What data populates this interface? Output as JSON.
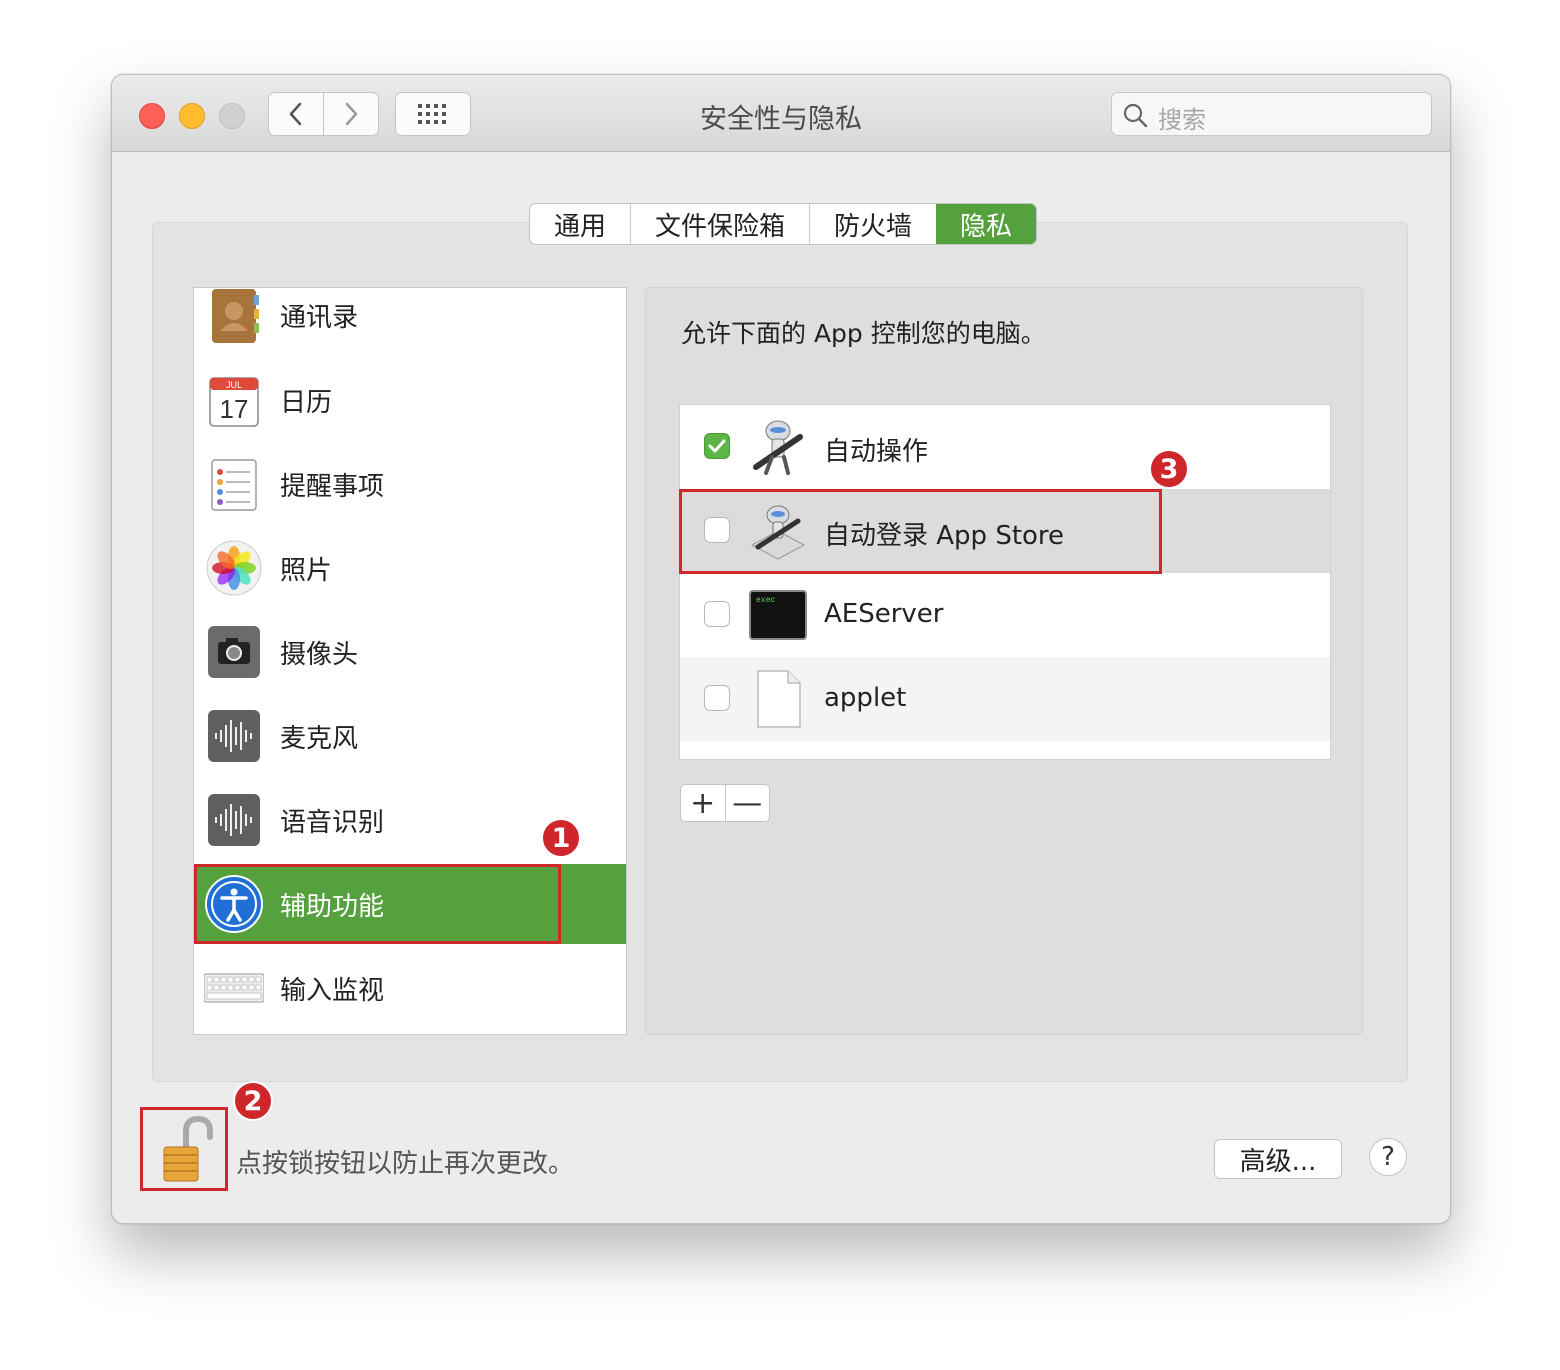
{
  "window": {
    "title": "安全性与隐私",
    "search_placeholder": "搜索"
  },
  "tabs": [
    {
      "label": "通用",
      "active": false
    },
    {
      "label": "文件保险箱",
      "active": false
    },
    {
      "label": "防火墙",
      "active": false
    },
    {
      "label": "隐私",
      "active": true
    }
  ],
  "sidebar": {
    "items": [
      {
        "label": "通讯录",
        "icon": "contacts-icon"
      },
      {
        "label": "日历",
        "icon": "calendar-icon",
        "calendar_month": "JUL",
        "calendar_day": "17"
      },
      {
        "label": "提醒事项",
        "icon": "reminders-icon"
      },
      {
        "label": "照片",
        "icon": "photos-icon"
      },
      {
        "label": "摄像头",
        "icon": "camera-icon"
      },
      {
        "label": "麦克风",
        "icon": "microphone-icon"
      },
      {
        "label": "语音识别",
        "icon": "speech-recognition-icon"
      },
      {
        "label": "辅助功能",
        "icon": "accessibility-icon",
        "selected": true
      },
      {
        "label": "输入监视",
        "icon": "keyboard-icon"
      }
    ]
  },
  "panel": {
    "description": "允许下面的 App 控制您的电脑。",
    "apps": [
      {
        "label": "自动操作",
        "checked": true,
        "icon": "automator-icon"
      },
      {
        "label": "自动登录 App Store",
        "checked": false,
        "icon": "automator-workflow-icon"
      },
      {
        "label": "AEServer",
        "checked": false,
        "icon": "terminal-exec-icon",
        "icon_text": "exec"
      },
      {
        "label": "applet",
        "checked": false,
        "icon": "document-icon"
      }
    ],
    "add_label": "+",
    "remove_label": "—"
  },
  "footer": {
    "lock_message": "点按锁按钮以防止再次更改。",
    "advanced_label": "高级...",
    "help_label": "?"
  },
  "annotations": {
    "marker_1": "1",
    "marker_2": "2",
    "marker_3": "3"
  },
  "colors": {
    "accent_green": "#55a13e",
    "annotation_red": "#d0272c",
    "close": "#fe5f57",
    "minimize": "#febc2e"
  }
}
